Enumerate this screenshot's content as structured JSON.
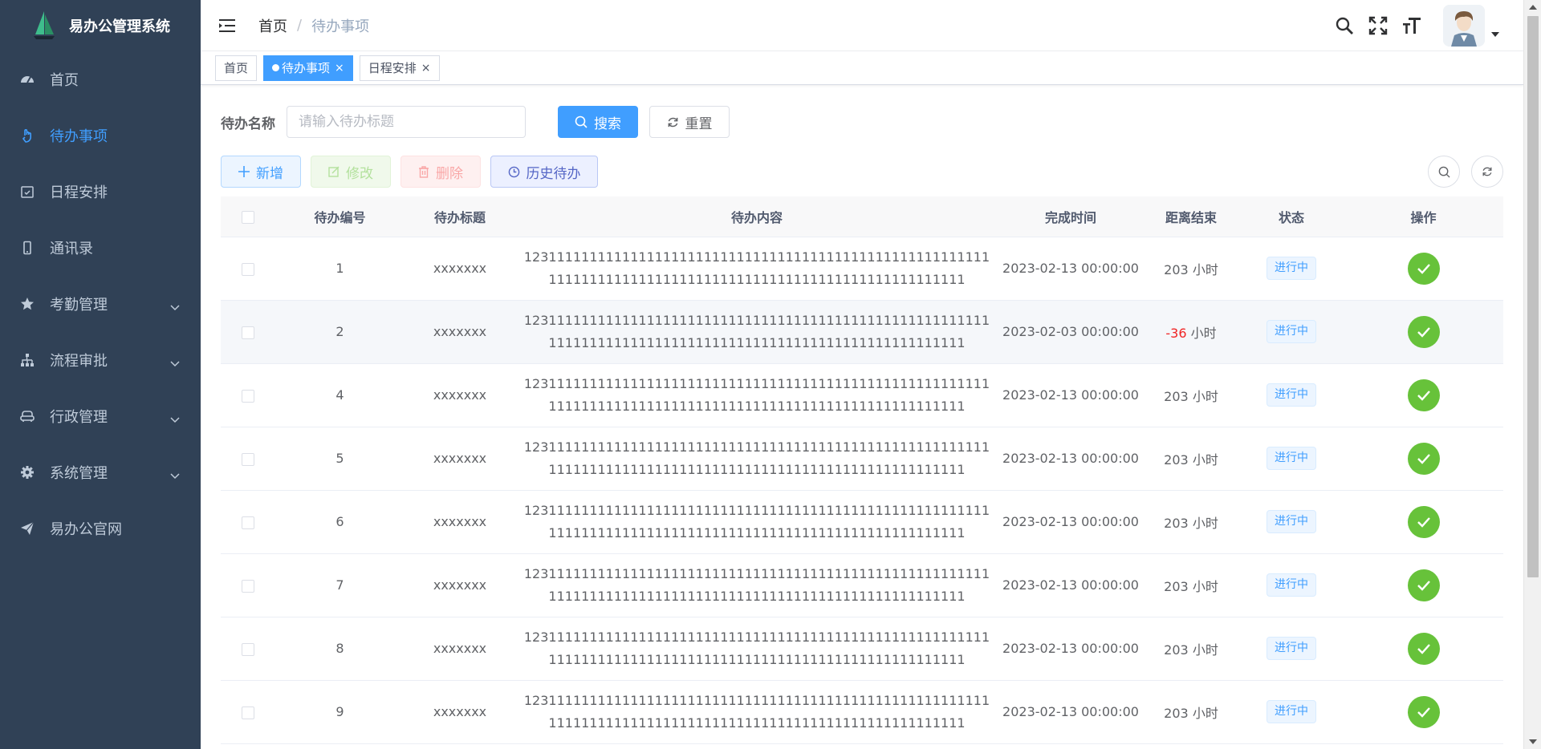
{
  "app": {
    "title": "易办公管理系统"
  },
  "sidebar": {
    "items": [
      {
        "label": "首页",
        "icon": "dashboard-icon",
        "expandable": false
      },
      {
        "label": "待办事项",
        "icon": "hand-icon",
        "expandable": false,
        "active": true
      },
      {
        "label": "日程安排",
        "icon": "calendar-check-icon",
        "expandable": false
      },
      {
        "label": "通讯录",
        "icon": "phone-icon",
        "expandable": false
      },
      {
        "label": "考勤管理",
        "icon": "star-icon",
        "expandable": true
      },
      {
        "label": "流程审批",
        "icon": "tree-icon",
        "expandable": true
      },
      {
        "label": "行政管理",
        "icon": "sofa-icon",
        "expandable": true
      },
      {
        "label": "系统管理",
        "icon": "gear-icon",
        "expandable": true
      },
      {
        "label": "易办公官网",
        "icon": "send-icon",
        "expandable": false
      }
    ]
  },
  "breadcrumb": {
    "home": "首页",
    "sep": "/",
    "current": "待办事项"
  },
  "tags": [
    {
      "label": "首页",
      "active": false,
      "closable": false
    },
    {
      "label": "待办事项",
      "active": true,
      "closable": true
    },
    {
      "label": "日程安排",
      "active": false,
      "closable": true
    }
  ],
  "search": {
    "label": "待办名称",
    "placeholder": "请输入待办标题",
    "search_btn": "搜索",
    "reset_btn": "重置"
  },
  "toolbar": {
    "add": "新增",
    "edit": "修改",
    "delete": "删除",
    "history": "历史待办"
  },
  "table": {
    "columns": [
      "待办编号",
      "待办标题",
      "待办内容",
      "完成时间",
      "距离结束",
      "状态",
      "操作"
    ],
    "unit": "小时",
    "rows": [
      {
        "id": "1",
        "title": "xxxxxxx",
        "content": "123111111111111111111111111111111111111111111111111111111111111111111111111111111111111111111111111111111111",
        "time": "2023-02-13 00:00:00",
        "remain": "203",
        "negative": false,
        "status": "进行中"
      },
      {
        "id": "2",
        "title": "xxxxxxx",
        "content": "123111111111111111111111111111111111111111111111111111111111111111111111111111111111111111111111111111111111",
        "time": "2023-02-03 00:00:00",
        "remain": "-36",
        "negative": true,
        "status": "进行中"
      },
      {
        "id": "4",
        "title": "xxxxxxx",
        "content": "123111111111111111111111111111111111111111111111111111111111111111111111111111111111111111111111111111111111",
        "time": "2023-02-13 00:00:00",
        "remain": "203",
        "negative": false,
        "status": "进行中"
      },
      {
        "id": "5",
        "title": "xxxxxxx",
        "content": "123111111111111111111111111111111111111111111111111111111111111111111111111111111111111111111111111111111111",
        "time": "2023-02-13 00:00:00",
        "remain": "203",
        "negative": false,
        "status": "进行中"
      },
      {
        "id": "6",
        "title": "xxxxxxx",
        "content": "123111111111111111111111111111111111111111111111111111111111111111111111111111111111111111111111111111111111",
        "time": "2023-02-13 00:00:00",
        "remain": "203",
        "negative": false,
        "status": "进行中"
      },
      {
        "id": "7",
        "title": "xxxxxxx",
        "content": "123111111111111111111111111111111111111111111111111111111111111111111111111111111111111111111111111111111111",
        "time": "2023-02-13 00:00:00",
        "remain": "203",
        "negative": false,
        "status": "进行中"
      },
      {
        "id": "8",
        "title": "xxxxxxx",
        "content": "123111111111111111111111111111111111111111111111111111111111111111111111111111111111111111111111111111111111",
        "time": "2023-02-13 00:00:00",
        "remain": "203",
        "negative": false,
        "status": "进行中"
      },
      {
        "id": "9",
        "title": "xxxxxxx",
        "content": "123111111111111111111111111111111111111111111111111111111111111111111111111111111111111111111111111111111111",
        "time": "2023-02-13 00:00:00",
        "remain": "203",
        "negative": false,
        "status": "进行中"
      }
    ]
  },
  "colors": {
    "sidebar_bg": "#304156",
    "primary": "#409eff",
    "success": "#67c23a",
    "danger": "#f02424"
  }
}
